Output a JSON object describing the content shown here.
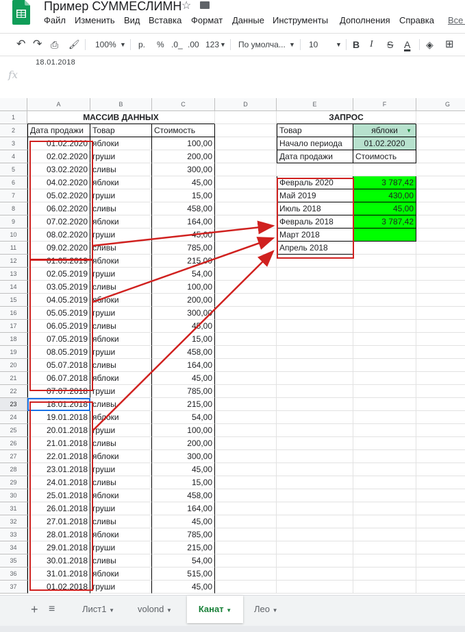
{
  "app": {
    "title": "Пример СУММЕСЛИМН",
    "menu": [
      "Файл",
      "Изменить",
      "Вид",
      "Вставка",
      "Формат",
      "Данные",
      "Инструменты",
      "Дополнения",
      "Справка"
    ],
    "menu_right": "Все и"
  },
  "toolbar": {
    "zoom": "100%",
    "currency": "р.",
    "percent": "%",
    "dec_less": ".0_",
    "dec_more": ".00",
    "format": "123",
    "font": "По умолча...",
    "font_size": "10",
    "bold": "B",
    "italic": "I",
    "strike": "S",
    "text_color": "A"
  },
  "formula_bar": {
    "cell_value": "18.01.2018",
    "fx": "fx"
  },
  "columns": [
    "A",
    "B",
    "C",
    "D",
    "E",
    "F",
    "G"
  ],
  "row_numbers": [
    "1",
    "2",
    "3",
    "4",
    "5",
    "6",
    "7",
    "8",
    "9",
    "10",
    "11",
    "12",
    "13",
    "14",
    "15",
    "16",
    "17",
    "18",
    "19",
    "20",
    "21",
    "22",
    "23",
    "24",
    "25",
    "26",
    "27",
    "28",
    "29",
    "30",
    "31",
    "32",
    "33",
    "34",
    "35",
    "36",
    "37"
  ],
  "data_block": {
    "title": "МАССИВ ДАННЫХ",
    "headers": [
      "Дата продажи",
      "Товар",
      "Стоимость"
    ],
    "rows": [
      [
        "01.02.2020",
        "яблоки",
        "100,00"
      ],
      [
        "02.02.2020",
        "груши",
        "200,00"
      ],
      [
        "03.02.2020",
        "сливы",
        "300,00"
      ],
      [
        "04.02.2020",
        "яблоки",
        "45,00"
      ],
      [
        "05.02.2020",
        "груши",
        "15,00"
      ],
      [
        "06.02.2020",
        "сливы",
        "458,00"
      ],
      [
        "07.02.2020",
        "яблоки",
        "164,00"
      ],
      [
        "08.02.2020",
        "груши",
        "45,00"
      ],
      [
        "09.02.2020",
        "сливы",
        "785,00"
      ],
      [
        "01.05.2019",
        "яблоки",
        "215,00"
      ],
      [
        "02.05.2019",
        "груши",
        "54,00"
      ],
      [
        "03.05.2019",
        "сливы",
        "100,00"
      ],
      [
        "04.05.2019",
        "яблоки",
        "200,00"
      ],
      [
        "05.05.2019",
        "груши",
        "300,00"
      ],
      [
        "06.05.2019",
        "сливы",
        "45,00"
      ],
      [
        "07.05.2019",
        "яблоки",
        "15,00"
      ],
      [
        "08.05.2019",
        "груши",
        "458,00"
      ],
      [
        "05.07.2018",
        "сливы",
        "164,00"
      ],
      [
        "06.07.2018",
        "яблоки",
        "45,00"
      ],
      [
        "07.07.2018",
        "груши",
        "785,00"
      ],
      [
        "18.01.2018",
        "сливы",
        "215,00"
      ],
      [
        "19.01.2018",
        "яблоки",
        "54,00"
      ],
      [
        "20.01.2018",
        "груши",
        "100,00"
      ],
      [
        "21.01.2018",
        "сливы",
        "200,00"
      ],
      [
        "22.01.2018",
        "яблоки",
        "300,00"
      ],
      [
        "23.01.2018",
        "груши",
        "45,00"
      ],
      [
        "24.01.2018",
        "сливы",
        "15,00"
      ],
      [
        "25.01.2018",
        "яблоки",
        "458,00"
      ],
      [
        "26.01.2018",
        "груши",
        "164,00"
      ],
      [
        "27.01.2018",
        "сливы",
        "45,00"
      ],
      [
        "28.01.2018",
        "яблоки",
        "785,00"
      ],
      [
        "29.01.2018",
        "груши",
        "215,00"
      ],
      [
        "30.01.2018",
        "сливы",
        "54,00"
      ],
      [
        "31.01.2018",
        "яблоки",
        "515,00"
      ],
      [
        "01.02.2018",
        "груши",
        "45,00"
      ]
    ]
  },
  "query": {
    "title": "ЗАПРОС",
    "product_label": "Товар",
    "product_value": "яблоки",
    "period_label": "Начало периода",
    "period_value": "01.02.2020",
    "date_label": "Дата продажи",
    "cost_label": "Стоимость",
    "results": [
      [
        "Февраль 2020",
        "3 787,42"
      ],
      [
        "Май 2019",
        "430,00"
      ],
      [
        "Июль 2018",
        "45,00"
      ],
      [
        "Февраль 2018",
        "3 787,42"
      ],
      [
        "Март 2018",
        ""
      ],
      [
        "Апрель 2018",
        ""
      ]
    ]
  },
  "sheet_tabs": [
    "Лист1",
    "volond",
    "Канат",
    "Лео"
  ],
  "active_tab": "Канат",
  "colors": {
    "green_fill": "#00ff00",
    "light_green": "#b7e1cd",
    "red": "#d0211f",
    "tab_green": "#188038"
  }
}
